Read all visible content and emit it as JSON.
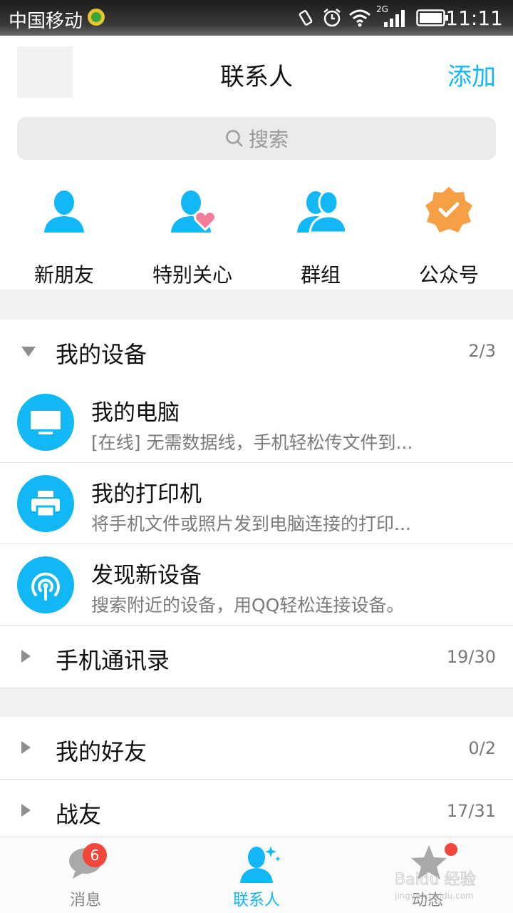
{
  "status_bar": {
    "carrier": "中国移动",
    "network": "2G",
    "time": "11:11"
  },
  "header": {
    "title": "联系人",
    "add_label": "添加"
  },
  "search": {
    "placeholder": "搜索"
  },
  "quick_actions": [
    {
      "label": "新朋友",
      "icon": "person-icon"
    },
    {
      "label": "特别关心",
      "icon": "person-heart-icon"
    },
    {
      "label": "群组",
      "icon": "group-icon"
    },
    {
      "label": "公众号",
      "icon": "verified-badge-icon"
    }
  ],
  "groups": {
    "devices": {
      "label": "我的设备",
      "count": "2/3",
      "expanded": true
    },
    "phone_contacts": {
      "label": "手机通讯录",
      "count": "19/30"
    },
    "friends": {
      "label": "我的好友",
      "count": "0/2"
    },
    "comrades": {
      "label": "战友",
      "count": "17/31"
    }
  },
  "devices": [
    {
      "title": "我的电脑",
      "subtitle": "[在线] 无需数据线，手机轻松传文件到...",
      "icon": "monitor-icon"
    },
    {
      "title": "我的打印机",
      "subtitle": "将手机文件或照片发到电脑连接的打印...",
      "icon": "printer-icon"
    },
    {
      "title": "发现新设备",
      "subtitle": "搜索附近的设备，用QQ轻松连接设备。",
      "icon": "radar-icon"
    }
  ],
  "bottom_nav": {
    "messages": {
      "label": "消息",
      "badge": "6"
    },
    "contacts": {
      "label": "联系人",
      "active": true
    },
    "feeds": {
      "label": "动态"
    }
  },
  "watermark": "Baidu 经验",
  "colors": {
    "accent": "#12b7f5",
    "official_account": "#f5a045",
    "badge_red": "#f2473a"
  }
}
